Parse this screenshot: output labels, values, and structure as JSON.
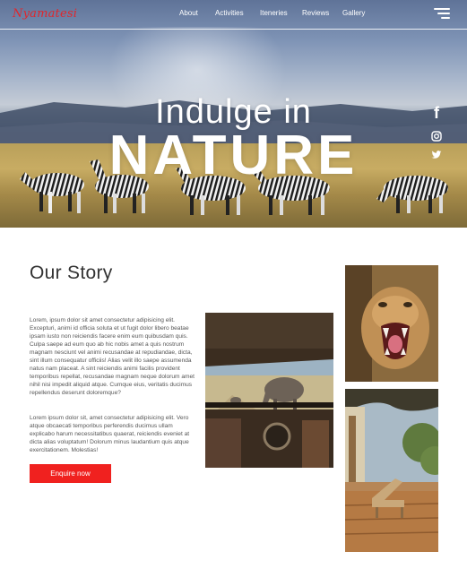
{
  "header": {
    "logo": "Nyamatesi",
    "nav": [
      "About",
      "Activities",
      "Iteneries",
      "Reviews",
      "Gallery"
    ],
    "menu_icon": "hamburger-menu-icon"
  },
  "hero": {
    "title_line1": "Indulge in",
    "title_line2": "NATURE",
    "social": [
      "facebook-icon",
      "instagram-icon",
      "twitter-icon"
    ]
  },
  "story": {
    "title": "Our Story",
    "paragraph1": "Lorem, ipsum dolor sit amet consectetur adipisicing elit. Excepturi, animi id officia soluta et ut fugit dolor libero beatae ipsam iusto non reiciendis facere enim eum quibusdam quis. Culpa saepe ad eum quo ab hic nobis amet a quis nostrum magnam nesciunt vel animi recusandae at repudiandae, dicta, sint illum consequatur officiis! Alias velit illo saepe assumenda natus nam placeat. A sint reiciendis animi facilis provident temporibus repellat, recusandae magnam neque dolorum amet nihil nisi impedit aliquid atque. Cumque eius, veritatis ducimus repellendus deserunt doloremque?",
    "paragraph2": "Lorem ipsum dolor sit, amet consectetur adipisicing elit. Vero atque obcaecati temporibus perferendis ducimus ullam explicabo harum necessitatibus quaerat, reiciendis eveniet at dicta alias voluptatum! Dolorum minus laudantium quis atque exercitationem. Molestias!",
    "cta": "Enquire now"
  },
  "colors": {
    "accent": "#f0211f",
    "logo": "#e0262c"
  }
}
